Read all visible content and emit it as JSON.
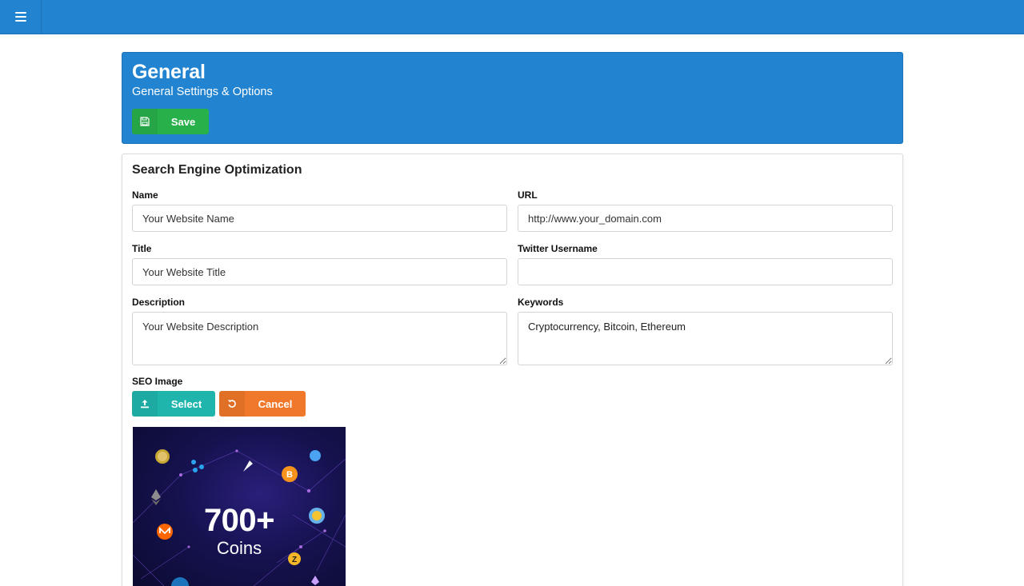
{
  "topbar": {
    "menu_icon": "hamburger-menu-icon"
  },
  "header": {
    "title": "General",
    "subtitle": "General Settings & Options",
    "save_label": "Save",
    "save_icon": "floppy-disk-icon"
  },
  "seo": {
    "section_title": "Search Engine Optimization",
    "name": {
      "label": "Name",
      "placeholder": "Your Website Name",
      "value": ""
    },
    "url": {
      "label": "URL",
      "placeholder": "http://www.your_domain.com",
      "value": ""
    },
    "title": {
      "label": "Title",
      "placeholder": "Your Website Title",
      "value": ""
    },
    "twitter": {
      "label": "Twitter Username",
      "placeholder": "",
      "value": ""
    },
    "description": {
      "label": "Description",
      "placeholder": "Your Website Description",
      "value": ""
    },
    "keywords": {
      "label": "Keywords",
      "placeholder": "",
      "value": "Cryptocurrency, Bitcoin, Ethereum"
    },
    "image": {
      "label": "SEO Image",
      "select_label": "Select",
      "select_icon": "upload-icon",
      "cancel_label": "Cancel",
      "cancel_icon": "undo-icon",
      "preview_number": "700+",
      "preview_word": "Coins"
    }
  },
  "colors": {
    "primary": "#2284d0",
    "save": "#28b04a",
    "select": "#1fb5ad",
    "cancel": "#f0782a"
  }
}
